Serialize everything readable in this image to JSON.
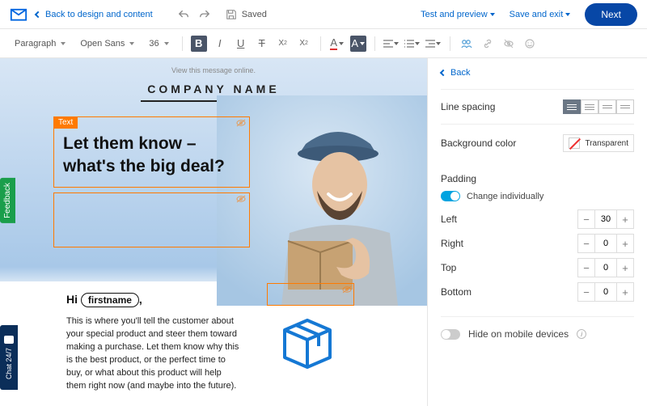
{
  "topbar": {
    "back_label": "Back to design and content",
    "saved_label": "Saved",
    "test_preview_label": "Test and preview",
    "save_exit_label": "Save and exit",
    "next_label": "Next"
  },
  "toolbar": {
    "style_label": "Paragraph",
    "font_label": "Open Sans",
    "size_label": "36"
  },
  "canvas": {
    "view_online_label": "View this message online.",
    "company_label": "COMPANY NAME",
    "text_tag_label": "Text",
    "headline_l1": "Let them know –",
    "headline_l2": "what's the big deal?",
    "greeting_hi": "Hi",
    "greeting_token": "firstname",
    "greeting_tail": ",",
    "body_text": "This is where you'll tell the customer about your special product and steer them toward making a purchase.   Let them know why this is the best product, or the perfect time to buy, or what about this product will help them right now (and maybe into the future)."
  },
  "panel": {
    "back_label": "Back",
    "line_spacing_label": "Line spacing",
    "bg_color_label": "Background color",
    "bg_swatch_label": "Transparent",
    "padding_label": "Padding",
    "change_indiv_label": "Change individually",
    "left_label": "Left",
    "right_label": "Right",
    "top_label": "Top",
    "bottom_label": "Bottom",
    "left_value": "30",
    "right_value": "0",
    "top_value": "0",
    "bottom_value": "0",
    "hide_mobile_label": "Hide on mobile devices"
  },
  "tabs": {
    "feedback_label": "Feedback",
    "chat_label": "Chat 24/7"
  }
}
